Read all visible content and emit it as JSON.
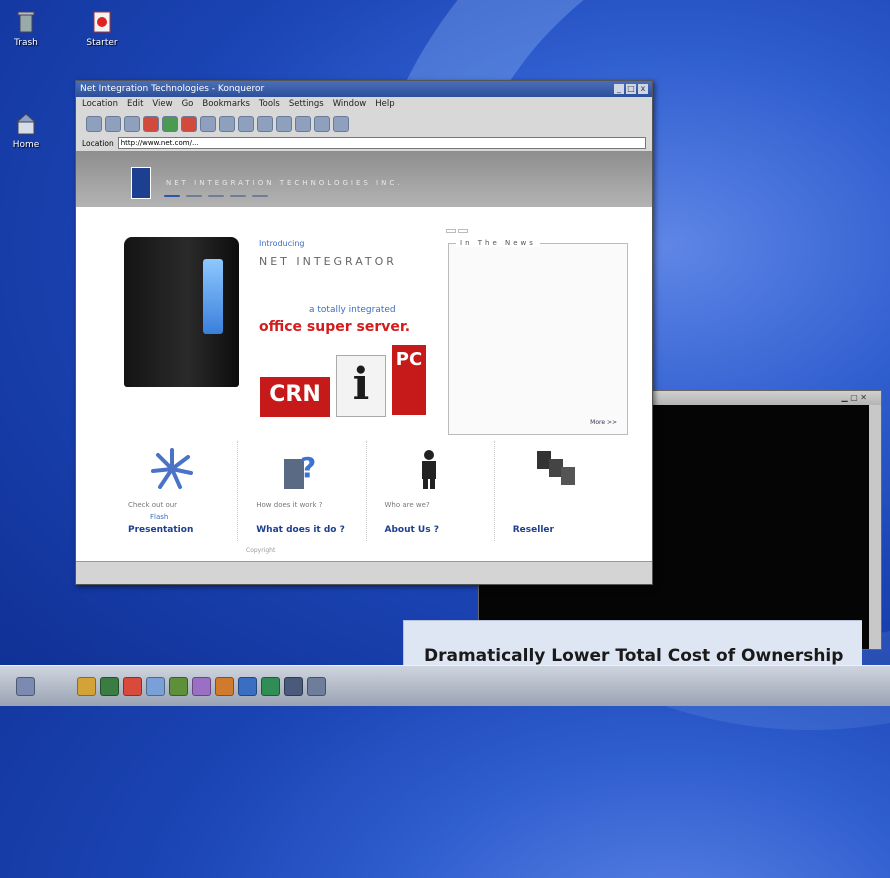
{
  "desktop": {
    "icons": [
      {
        "label": "Trash",
        "icon": "trash-icon"
      },
      {
        "label": "Starter",
        "icon": "starter-icon"
      },
      {
        "label": "Home",
        "icon": "home-folder-icon"
      }
    ]
  },
  "browser": {
    "title": "Net Integration Technologies - Konqueror",
    "menu": [
      "Location",
      "Edit",
      "View",
      "Go",
      "Bookmarks",
      "Tools",
      "Settings",
      "Window",
      "Help"
    ],
    "location_label": "Location",
    "url": "http://www.net.com/..."
  },
  "page": {
    "company_name": "NET INTEGRATION TECHNOLOGIES INC.",
    "nav": [
      "",
      "",
      "",
      "",
      ""
    ],
    "hero": {
      "intro": "Introducing",
      "product": "NET INTEGRATOR",
      "tagline_1": "a totally integrated",
      "tagline_2": "office super server.",
      "logo_crn": "CRN",
      "logo_i": "i",
      "logo_pc": "PC"
    },
    "news": {
      "tabs": [
        "",
        ""
      ],
      "title": "In The News",
      "items": [
        "",
        "",
        "",
        ""
      ],
      "more": "More >>"
    },
    "features": [
      {
        "caption": "Check out our",
        "sub": "Flash",
        "title": "Presentation"
      },
      {
        "caption": "How does it work ?",
        "sub": "",
        "title": "What does it do ?"
      },
      {
        "caption": "Who are we?",
        "sub": "",
        "title": "About Us ?"
      },
      {
        "caption": "",
        "sub": "",
        "title": "Reseller"
      }
    ],
    "footer": "Copyright"
  },
  "terminal": {
    "lines_left": [
      "",
      "",
      "",
      "",
      "",
      "",
      "",
      "",
      "",
      "",
      "",
      "",
      "",
      "",
      "",
      "",
      "",
      "",
      "",
      ""
    ],
    "lines_mid": [
      "",
      "",
      "",
      "",
      "",
      "",
      "",
      "",
      "",
      "",
      "",
      "",
      "",
      "",
      "",
      "",
      "",
      "",
      "",
      ""
    ],
    "lines_right": [
      "",
      "",
      "",
      "",
      "",
      "",
      "",
      "",
      "",
      "",
      "",
      "",
      "",
      "",
      "",
      "",
      "",
      "",
      "",
      ""
    ]
  },
  "caption": {
    "text": "Dramatically Lower Total Cost of Ownership"
  },
  "colors": {
    "desktop_blue": "#1b44b4",
    "caption_bg": "#dfe6f3",
    "brand_red": "#d31c1c",
    "brand_blue": "#1d3f8f"
  }
}
